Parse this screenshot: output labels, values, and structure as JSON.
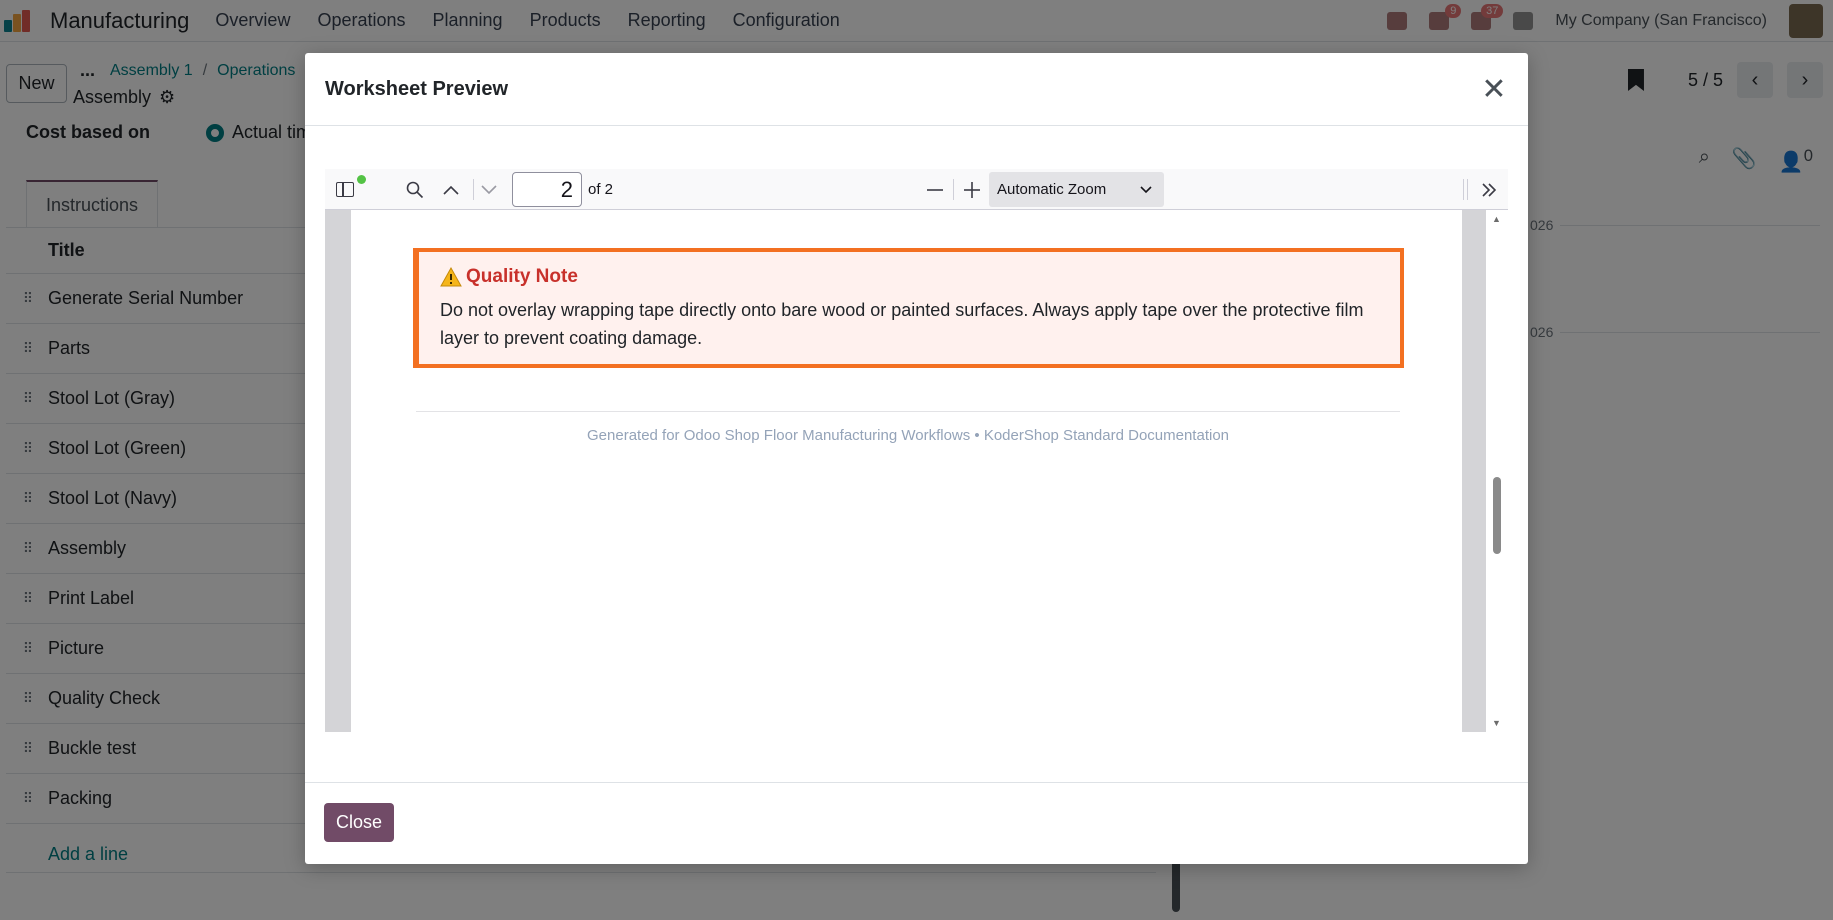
{
  "app": {
    "name": "Manufacturing",
    "logo_colors": [
      "#0b8290",
      "#f3a541",
      "#e2584e"
    ]
  },
  "menu": [
    "Overview",
    "Operations",
    "Planning",
    "Products",
    "Reporting",
    "Configuration"
  ],
  "systray": {
    "badge_1": "9",
    "badge_2": "37",
    "company": "My Company (San Francisco)"
  },
  "control": {
    "new_label": "New",
    "dots": "...",
    "breadcrumb": [
      "Assembly 1",
      "Operations"
    ],
    "record_title": "Assembly",
    "pager_value": "5 / 5"
  },
  "form": {
    "cost_label": "Cost based on",
    "cost_value": "Actual time",
    "tab_label": "Instructions",
    "column_title": "Title",
    "rows": [
      "Generate Serial Number",
      "Parts",
      "Stool Lot (Gray)",
      "Stool Lot (Green)",
      "Stool Lot (Navy)",
      "Assembly",
      "Print Label",
      "Picture",
      "Quality Check",
      "Buckle test",
      "Packing"
    ],
    "add_line": "Add a line"
  },
  "right_panel": {
    "follower_count": "0",
    "dates": [
      "026",
      "026"
    ]
  },
  "modal": {
    "title": "Worksheet Preview",
    "close_button": "Close",
    "viewer": {
      "current_page": "2",
      "page_of": "of 2",
      "zoom": "Automatic Zoom",
      "callout_title": "Quality Note",
      "callout_text": "Do not overlay wrapping tape directly onto bare wood or painted surfaces. Always apply tape over the protective film layer to prevent coating damage.",
      "footer": "Generated for Odoo Shop Floor Manufacturing Workflows • KoderShop Standard Documentation",
      "scroll_position": 0.55
    }
  },
  "colors": {
    "brand": "#714b67",
    "link": "#017e84",
    "callout_border": "#f37021",
    "callout_bg": "#fff1ee",
    "callout_title": "#c8312b",
    "footer_text": "#94a3b8"
  }
}
